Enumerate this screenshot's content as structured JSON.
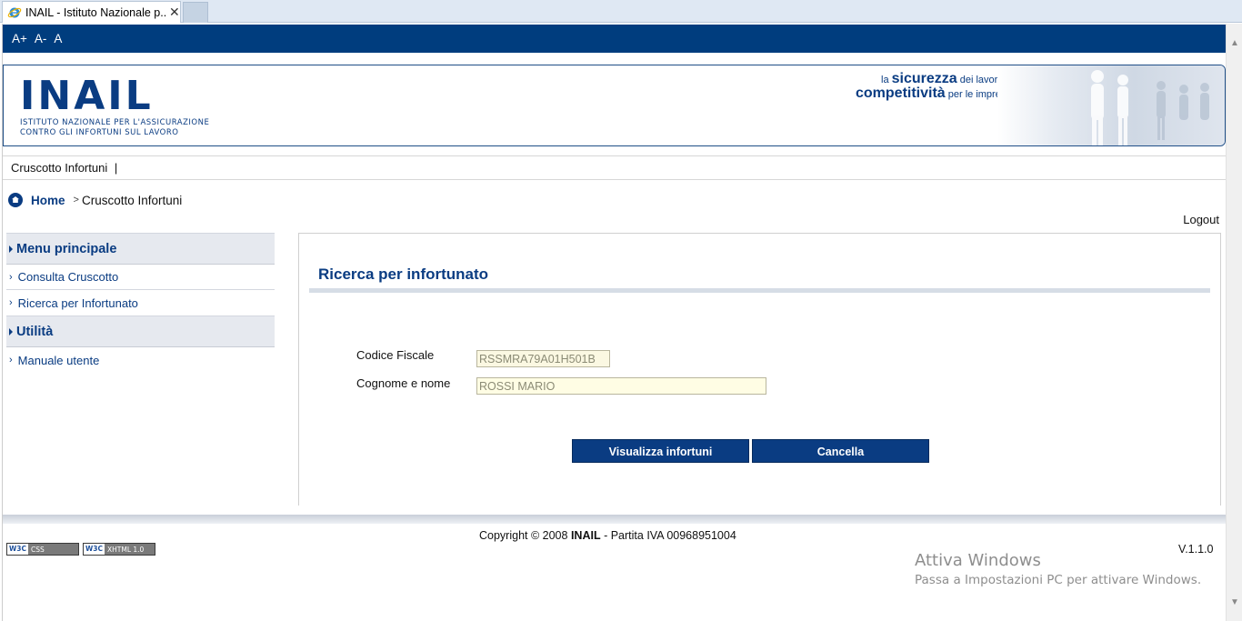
{
  "browser": {
    "tab_title": "INAIL - Istituto Nazionale p...",
    "close_glyph": "✕"
  },
  "accessibility": {
    "increase": "A+",
    "decrease": "A-",
    "reset": "A"
  },
  "header": {
    "logo_text": "INAIL",
    "logo_sub_line1": "ISTITUTO NAZIONALE PER L'ASSICURAZIONE",
    "logo_sub_line2": "CONTRO GLI INFORTUNI SUL LAVORO",
    "slogan": {
      "la": "la",
      "sicurezza": "sicurezza",
      "dei_lavoratori": "dei lavoratori è",
      "competitivita": "competitività",
      "per_le_imprese": "per le imprese"
    }
  },
  "sitenav": {
    "item": "Cruscotto Infortuni",
    "sep": "|"
  },
  "breadcrumb": {
    "home": "Home",
    "sep": ">",
    "current": "Cruscotto Infortuni"
  },
  "logout": "Logout",
  "sidebar": {
    "menu_title": "Menu principale",
    "items": [
      {
        "label": "Consulta Cruscotto"
      },
      {
        "label": "Ricerca per Infortunato"
      }
    ],
    "util_title": "Utilità",
    "util_items": [
      {
        "label": "Manuale utente"
      }
    ]
  },
  "form": {
    "title": "Ricerca per infortunato",
    "codice_fiscale_label": "Codice Fiscale",
    "codice_fiscale_value": "RSSMRA79A01H501B",
    "nome_label": "Cognome e nome",
    "nome_value": "ROSSI MARIO",
    "btn_view": "Visualizza infortuni",
    "btn_cancel": "Cancella"
  },
  "footer": {
    "copyright_prefix": "Copyright © 2008",
    "copyright_brand": "INAIL",
    "copyright_suffix": "- Partita IVA 00968951004",
    "badge_css": "CSS",
    "badge_xhtml": "XHTML 1.0",
    "badge_w3c": "W3C",
    "version": "V.1.1.0"
  },
  "os_overlay": {
    "line1": "Attiva Windows",
    "line2": "Passa a Impostazioni PC per attivare Windows."
  },
  "colors": {
    "brand_blue": "#0a3c82",
    "accbar": "#003d7e"
  }
}
